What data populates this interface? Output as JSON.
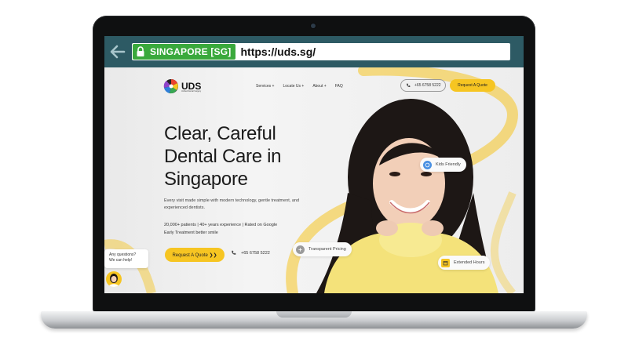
{
  "browser": {
    "ev_label": "SINGAPORE [SG]",
    "url": "https://uds.sg/"
  },
  "site": {
    "logo_text": "UDS",
    "logo_subtext": "Unified Dental Surgery",
    "nav": [
      "Services +",
      "Locate Us +",
      "About +",
      "FAQ"
    ],
    "header_phone": "+65 6758 5222",
    "header_cta": "Request A Quote",
    "hero": {
      "title_lines": [
        "Clear, Careful",
        "Dental Care in",
        "Singapore"
      ],
      "subtitle": "Every visit made simple with modern technology, gentle treatment, and experienced dentists.",
      "stats": "20,000+ patients | 40+ years experience | Rated on Google",
      "tagline": "Early Treatment better smile",
      "cta": "Request A Quote ❯❯",
      "phone": "+65 6758 5222"
    },
    "badges": {
      "kids": "Kids Friendly",
      "pricing": "Transparent Pricing",
      "hours": "Extended Hours"
    },
    "chat": {
      "line1": "Any questions?",
      "line2": "We can help!"
    }
  },
  "colors": {
    "accent": "#f6c522",
    "address_bar": "#2d5a64",
    "ev_green": "#3aa93c"
  }
}
